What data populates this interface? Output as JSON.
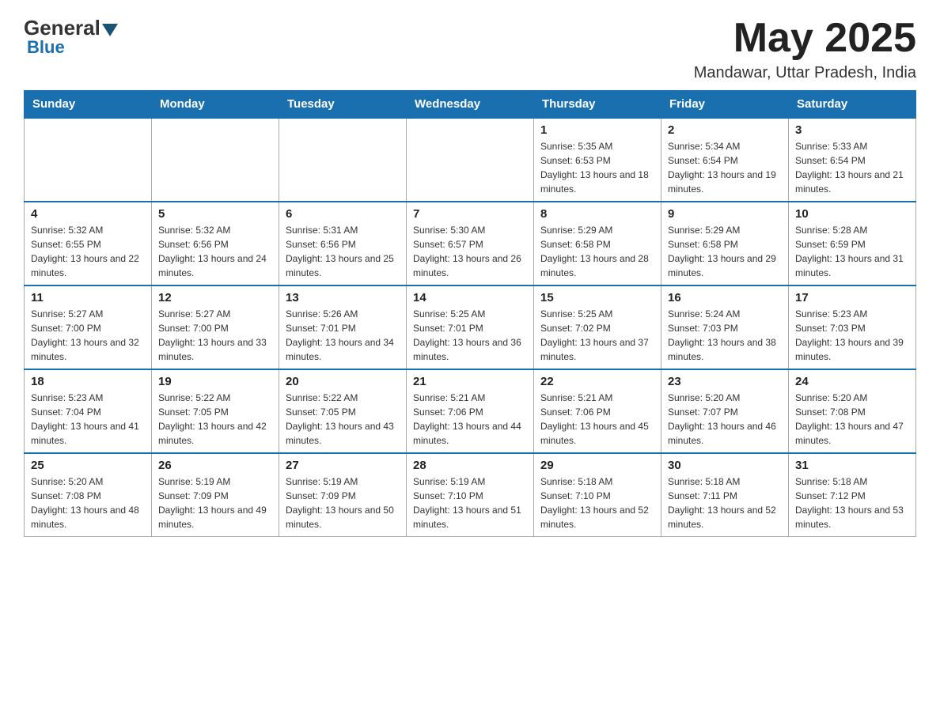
{
  "header": {
    "logo_general": "General",
    "logo_blue": "Blue",
    "month_title": "May 2025",
    "subtitle": "Mandawar, Uttar Pradesh, India"
  },
  "weekdays": [
    "Sunday",
    "Monday",
    "Tuesday",
    "Wednesday",
    "Thursday",
    "Friday",
    "Saturday"
  ],
  "weeks": [
    [
      {
        "day": "",
        "info": ""
      },
      {
        "day": "",
        "info": ""
      },
      {
        "day": "",
        "info": ""
      },
      {
        "day": "",
        "info": ""
      },
      {
        "day": "1",
        "info": "Sunrise: 5:35 AM\nSunset: 6:53 PM\nDaylight: 13 hours and 18 minutes."
      },
      {
        "day": "2",
        "info": "Sunrise: 5:34 AM\nSunset: 6:54 PM\nDaylight: 13 hours and 19 minutes."
      },
      {
        "day": "3",
        "info": "Sunrise: 5:33 AM\nSunset: 6:54 PM\nDaylight: 13 hours and 21 minutes."
      }
    ],
    [
      {
        "day": "4",
        "info": "Sunrise: 5:32 AM\nSunset: 6:55 PM\nDaylight: 13 hours and 22 minutes."
      },
      {
        "day": "5",
        "info": "Sunrise: 5:32 AM\nSunset: 6:56 PM\nDaylight: 13 hours and 24 minutes."
      },
      {
        "day": "6",
        "info": "Sunrise: 5:31 AM\nSunset: 6:56 PM\nDaylight: 13 hours and 25 minutes."
      },
      {
        "day": "7",
        "info": "Sunrise: 5:30 AM\nSunset: 6:57 PM\nDaylight: 13 hours and 26 minutes."
      },
      {
        "day": "8",
        "info": "Sunrise: 5:29 AM\nSunset: 6:58 PM\nDaylight: 13 hours and 28 minutes."
      },
      {
        "day": "9",
        "info": "Sunrise: 5:29 AM\nSunset: 6:58 PM\nDaylight: 13 hours and 29 minutes."
      },
      {
        "day": "10",
        "info": "Sunrise: 5:28 AM\nSunset: 6:59 PM\nDaylight: 13 hours and 31 minutes."
      }
    ],
    [
      {
        "day": "11",
        "info": "Sunrise: 5:27 AM\nSunset: 7:00 PM\nDaylight: 13 hours and 32 minutes."
      },
      {
        "day": "12",
        "info": "Sunrise: 5:27 AM\nSunset: 7:00 PM\nDaylight: 13 hours and 33 minutes."
      },
      {
        "day": "13",
        "info": "Sunrise: 5:26 AM\nSunset: 7:01 PM\nDaylight: 13 hours and 34 minutes."
      },
      {
        "day": "14",
        "info": "Sunrise: 5:25 AM\nSunset: 7:01 PM\nDaylight: 13 hours and 36 minutes."
      },
      {
        "day": "15",
        "info": "Sunrise: 5:25 AM\nSunset: 7:02 PM\nDaylight: 13 hours and 37 minutes."
      },
      {
        "day": "16",
        "info": "Sunrise: 5:24 AM\nSunset: 7:03 PM\nDaylight: 13 hours and 38 minutes."
      },
      {
        "day": "17",
        "info": "Sunrise: 5:23 AM\nSunset: 7:03 PM\nDaylight: 13 hours and 39 minutes."
      }
    ],
    [
      {
        "day": "18",
        "info": "Sunrise: 5:23 AM\nSunset: 7:04 PM\nDaylight: 13 hours and 41 minutes."
      },
      {
        "day": "19",
        "info": "Sunrise: 5:22 AM\nSunset: 7:05 PM\nDaylight: 13 hours and 42 minutes."
      },
      {
        "day": "20",
        "info": "Sunrise: 5:22 AM\nSunset: 7:05 PM\nDaylight: 13 hours and 43 minutes."
      },
      {
        "day": "21",
        "info": "Sunrise: 5:21 AM\nSunset: 7:06 PM\nDaylight: 13 hours and 44 minutes."
      },
      {
        "day": "22",
        "info": "Sunrise: 5:21 AM\nSunset: 7:06 PM\nDaylight: 13 hours and 45 minutes."
      },
      {
        "day": "23",
        "info": "Sunrise: 5:20 AM\nSunset: 7:07 PM\nDaylight: 13 hours and 46 minutes."
      },
      {
        "day": "24",
        "info": "Sunrise: 5:20 AM\nSunset: 7:08 PM\nDaylight: 13 hours and 47 minutes."
      }
    ],
    [
      {
        "day": "25",
        "info": "Sunrise: 5:20 AM\nSunset: 7:08 PM\nDaylight: 13 hours and 48 minutes."
      },
      {
        "day": "26",
        "info": "Sunrise: 5:19 AM\nSunset: 7:09 PM\nDaylight: 13 hours and 49 minutes."
      },
      {
        "day": "27",
        "info": "Sunrise: 5:19 AM\nSunset: 7:09 PM\nDaylight: 13 hours and 50 minutes."
      },
      {
        "day": "28",
        "info": "Sunrise: 5:19 AM\nSunset: 7:10 PM\nDaylight: 13 hours and 51 minutes."
      },
      {
        "day": "29",
        "info": "Sunrise: 5:18 AM\nSunset: 7:10 PM\nDaylight: 13 hours and 52 minutes."
      },
      {
        "day": "30",
        "info": "Sunrise: 5:18 AM\nSunset: 7:11 PM\nDaylight: 13 hours and 52 minutes."
      },
      {
        "day": "31",
        "info": "Sunrise: 5:18 AM\nSunset: 7:12 PM\nDaylight: 13 hours and 53 minutes."
      }
    ]
  ]
}
